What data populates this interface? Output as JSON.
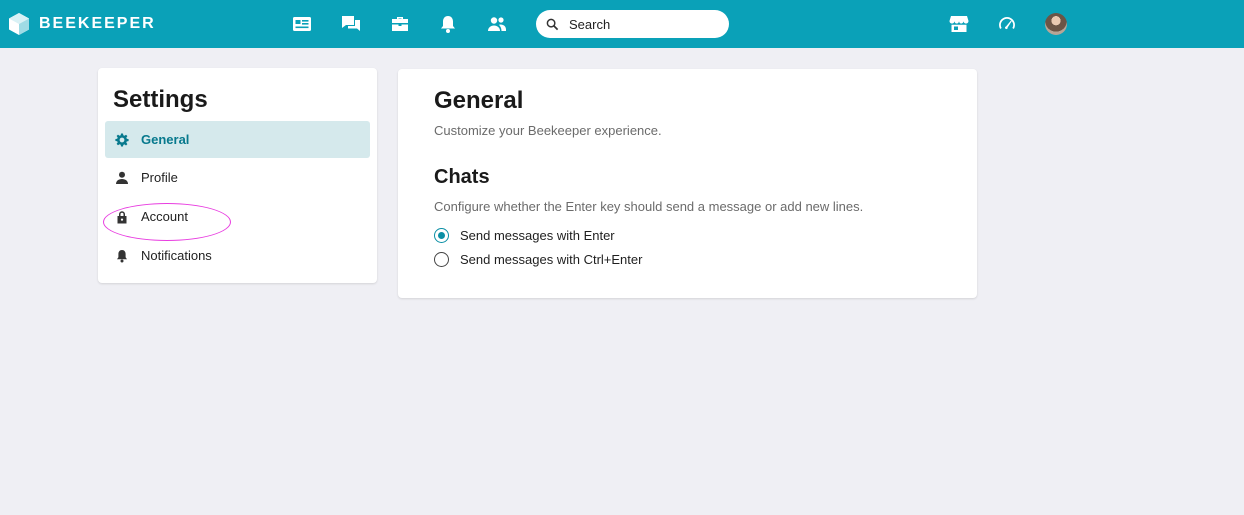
{
  "app": {
    "name": "BEEKEEPER",
    "brand_color": "#0aa1b8",
    "accent_color": "#07798d"
  },
  "header": {
    "nav_icons": [
      "news-feed-icon",
      "chat-icon",
      "toolbox-icon",
      "bell-icon",
      "people-icon"
    ],
    "search": {
      "placeholder": "Search"
    },
    "right_icons": [
      "store-icon",
      "dashboard-gauge-icon",
      "user-avatar"
    ]
  },
  "sidebar": {
    "title": "Settings",
    "items": [
      {
        "label": "General",
        "icon": "gear-icon",
        "active": true
      },
      {
        "label": "Profile",
        "icon": "person-icon",
        "active": false
      },
      {
        "label": "Account",
        "icon": "lock-icon",
        "active": false
      },
      {
        "label": "Notifications",
        "icon": "bell-icon",
        "active": false
      }
    ]
  },
  "main": {
    "title": "General",
    "subtitle": "Customize your Beekeeper experience.",
    "chats": {
      "title": "Chats",
      "description": "Configure whether the Enter key should send a message or add new lines.",
      "options": [
        {
          "label": "Send messages with Enter",
          "selected": true
        },
        {
          "label": "Send messages with Ctrl+Enter",
          "selected": false
        }
      ]
    }
  }
}
